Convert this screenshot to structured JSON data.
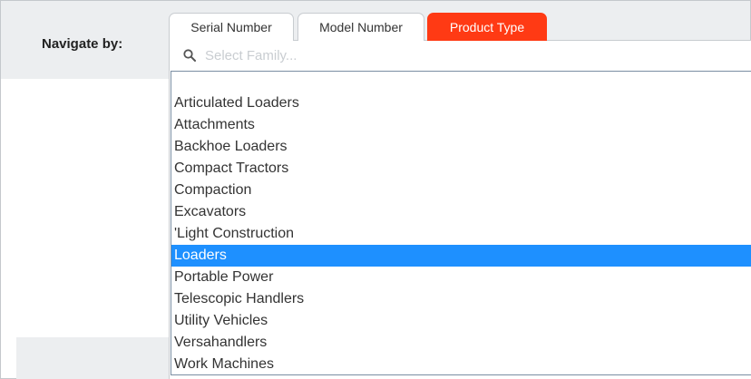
{
  "navigate": {
    "label": "Navigate by:"
  },
  "tabs": [
    {
      "label": "Serial Number",
      "active": false
    },
    {
      "label": "Model Number",
      "active": false
    },
    {
      "label": "Product Type",
      "active": true
    }
  ],
  "search": {
    "placeholder": "Select Family...",
    "value": ""
  },
  "families": {
    "items": [
      "Articulated Loaders",
      "Attachments",
      "Backhoe Loaders",
      "Compact Tractors",
      "Compaction",
      "Excavators",
      "'Light Construction",
      "Loaders",
      "Portable Power",
      "Telescopic Handlers",
      "Utility Vehicles",
      "Versahandlers",
      "Work Machines"
    ],
    "selected": "Loaders"
  },
  "colors": {
    "active_tab": "#ff3a14",
    "selection": "#1e90ff",
    "header_band": "#eceef0"
  }
}
